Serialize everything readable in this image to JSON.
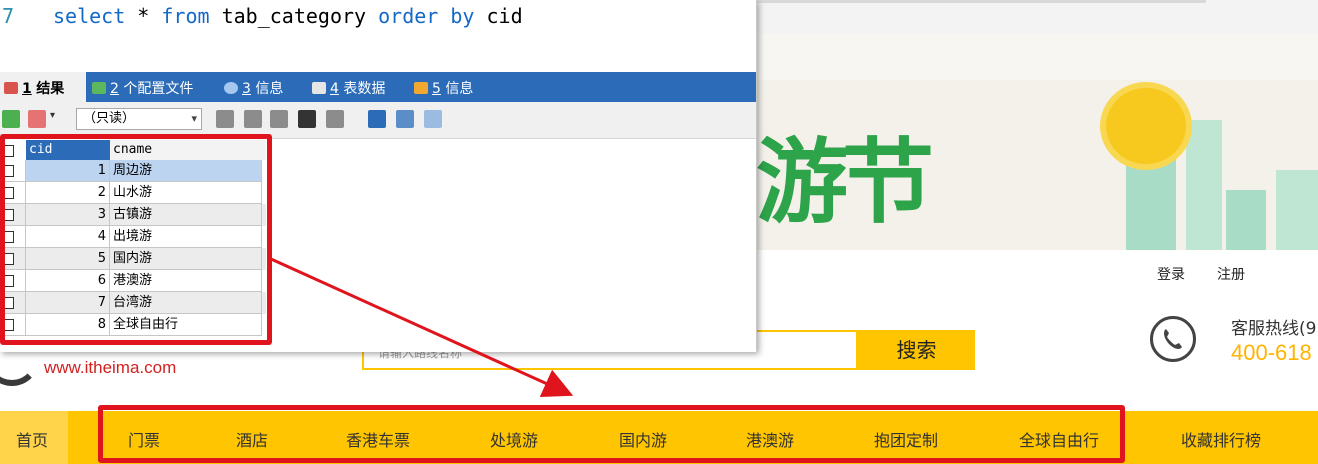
{
  "sql_editor": {
    "line_number": "7",
    "query": {
      "kw1": "select",
      "star": " * ",
      "kw2": "from",
      "table": " tab_category ",
      "kw3": "order by",
      "col": " cid"
    }
  },
  "result_tabs": [
    {
      "num": "1",
      "label": "结果"
    },
    {
      "num": "2",
      "label": "个配置文件"
    },
    {
      "num": "3",
      "label": "信息"
    },
    {
      "num": "4",
      "label": "表数据"
    },
    {
      "num": "5",
      "label": "信息"
    }
  ],
  "toolbar": {
    "mode": "（只读）"
  },
  "grid": {
    "columns": [
      "cid",
      "cname"
    ],
    "rows": [
      {
        "cid": "1",
        "cname": "周边游"
      },
      {
        "cid": "2",
        "cname": "山水游"
      },
      {
        "cid": "3",
        "cname": "古镇游"
      },
      {
        "cid": "4",
        "cname": "出境游"
      },
      {
        "cid": "5",
        "cname": "国内游"
      },
      {
        "cid": "6",
        "cname": "港澳游"
      },
      {
        "cid": "7",
        "cname": "台湾游"
      },
      {
        "cid": "8",
        "cname": "全球自由行"
      }
    ]
  },
  "website": {
    "banner_title": "游节",
    "login": "登录",
    "register": "注册",
    "logo_url": "www.itheima.com",
    "search_placeholder": "请输入路线名称",
    "search_button": "搜索",
    "hotline_label": "客服热线(9",
    "hotline_number": "400-618",
    "nav": [
      "首页",
      "门票",
      "酒店",
      "香港车票",
      "处境游",
      "国内游",
      "港澳游",
      "抱团定制",
      "全球自由行",
      "收藏排行榜"
    ]
  },
  "colors": {
    "accent": "#ffc500",
    "callout": "#e0141c",
    "tabbar": "#2c6bb7"
  }
}
